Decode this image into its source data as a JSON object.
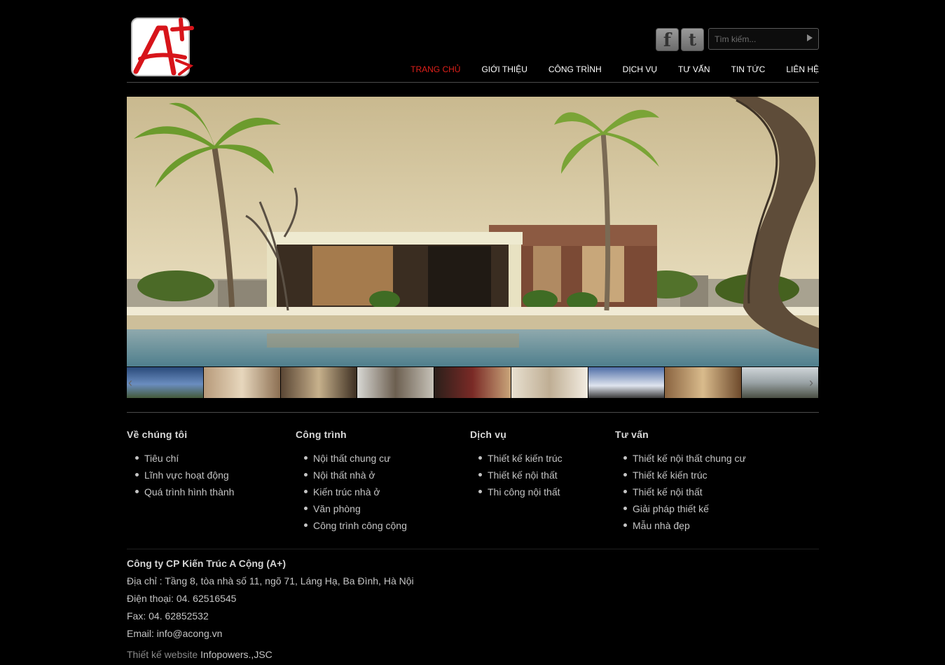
{
  "brand": {
    "logo_text": "A+",
    "accent": "#e0201a"
  },
  "search": {
    "placeholder": "Tìm kiếm..."
  },
  "social": {
    "facebook_icon": "facebook-icon",
    "twitter_icon": "twitter-icon"
  },
  "nav": {
    "items": [
      {
        "label": "TRANG CHỦ",
        "active": true
      },
      {
        "label": "GIỚI THIỆU"
      },
      {
        "label": "CÔNG TRÌNH"
      },
      {
        "label": "DỊCH VỤ"
      },
      {
        "label": "TƯ VẤN"
      },
      {
        "label": "TIN TỨC"
      },
      {
        "label": "LIÊN HỆ"
      }
    ]
  },
  "footer": {
    "columns": [
      {
        "title": "Về chúng tôi",
        "items": [
          "Tiêu chí",
          "Lĩnh vực hoạt động",
          "Quá trình hình thành"
        ]
      },
      {
        "title": "Công trình",
        "items": [
          "Nội thất chung cư",
          "Nội thất nhà ở",
          "Kiến trúc nhà ở",
          "Văn phòng",
          "Công trình công cộng"
        ]
      },
      {
        "title": "Dịch vụ",
        "items": [
          "Thiết kế kiến trúc",
          "Thiết kế nội thất",
          "Thi công nội thất"
        ]
      },
      {
        "title": "Tư vấn",
        "items": [
          "Thiết kế nội thất chung cư",
          "Thiết kế kiến trúc",
          "Thiết kế nội thất",
          "Giải pháp thiết kế",
          "Mẫu nhà đẹp"
        ]
      }
    ],
    "company": "Công ty CP Kiến Trúc A Cộng (A+)",
    "address": "Địa chỉ : Tầng 8, tòa nhà số 11, ngõ 71, Láng Hạ, Ba Đình, Hà Nội",
    "phone": "Điện thoại: 04. 62516545",
    "fax": "Fax: 04. 62852532",
    "email_label": "Email: ",
    "email": "info@acong.vn",
    "credit_label": "Thiết kế website ",
    "credit_link": "Infopowers.,JSC"
  }
}
